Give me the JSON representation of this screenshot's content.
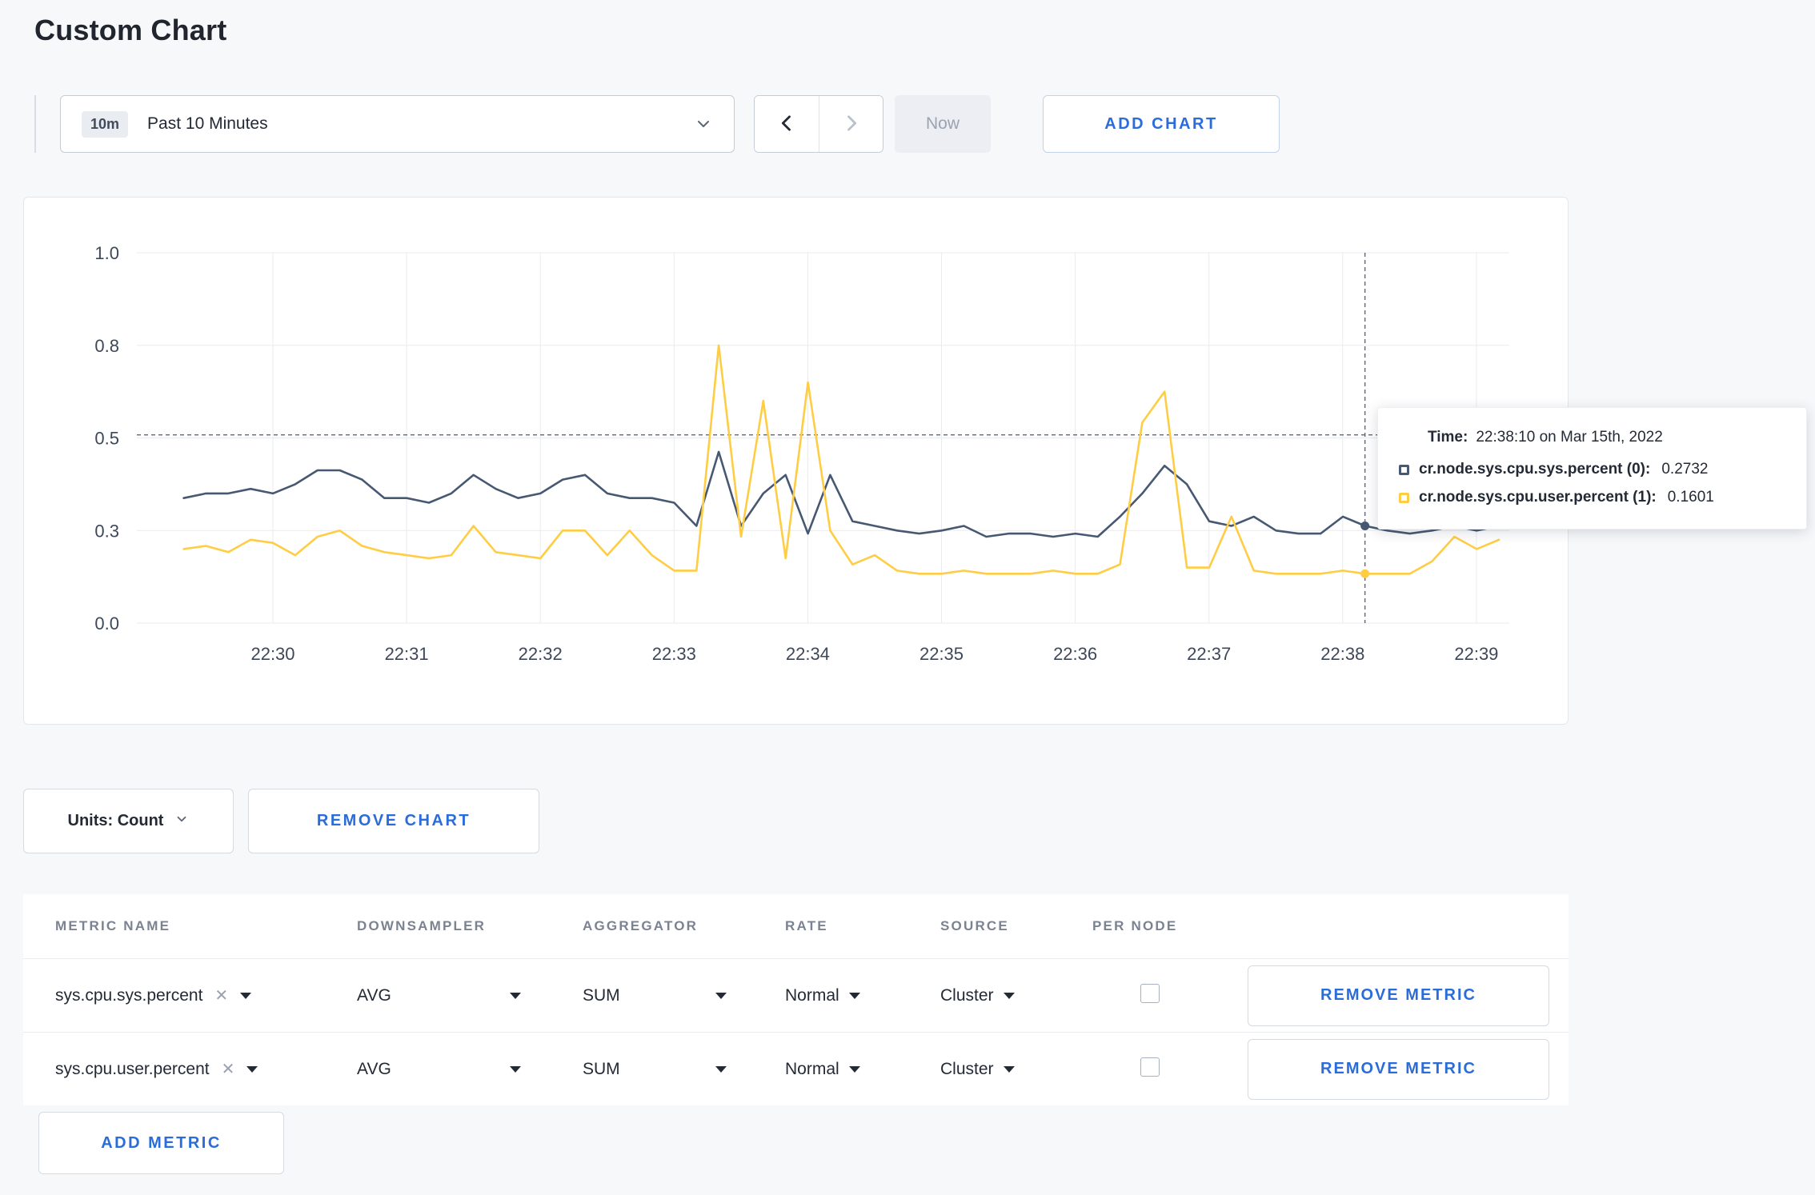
{
  "page": {
    "title": "Custom Chart"
  },
  "toolbar": {
    "time_range_badge": "10m",
    "time_range_label": "Past 10 Minutes",
    "now_label": "Now",
    "add_chart_label": "ADD CHART"
  },
  "controls": {
    "units_label": "Units: Count",
    "remove_chart_label": "REMOVE CHART",
    "add_metric_label": "ADD METRIC"
  },
  "icons": {
    "close": "✕"
  },
  "colors": {
    "accent_blue": "#2a6cd9"
  },
  "tooltip": {
    "time_label": "Time:",
    "time_value": "22:38:10 on Mar 15th, 2022",
    "series": [
      {
        "name": "cr.node.sys.cpu.sys.percent (0):",
        "value": "0.2732",
        "color": "#475872"
      },
      {
        "name": "cr.node.sys.cpu.user.percent (1):",
        "value": "0.1601",
        "color": "#ffcd44"
      }
    ]
  },
  "metrics_table": {
    "headers": [
      "METRIC NAME",
      "DOWNSAMPLER",
      "AGGREGATOR",
      "RATE",
      "SOURCE",
      "PER NODE"
    ],
    "rows": [
      {
        "metric": "sys.cpu.sys.percent",
        "downsampler": "AVG",
        "aggregator": "SUM",
        "rate": "Normal",
        "source": "Cluster",
        "per_node": false,
        "remove_label": "REMOVE METRIC"
      },
      {
        "metric": "sys.cpu.user.percent",
        "downsampler": "AVG",
        "aggregator": "SUM",
        "rate": "Normal",
        "source": "Cluster",
        "per_node": false,
        "remove_label": "REMOVE METRIC"
      }
    ]
  },
  "chart_data": {
    "type": "line",
    "title": "",
    "x_tick_labels": [
      "22:30",
      "22:31",
      "22:32",
      "22:33",
      "22:34",
      "22:35",
      "22:36",
      "22:37",
      "22:38",
      "22:39"
    ],
    "y_tick_labels": [
      "0.0",
      "0.3",
      "0.5",
      "0.8",
      "1.0"
    ],
    "y_tick_values": [
      0,
      0.3,
      0.5,
      0.8,
      1.0
    ],
    "x_start_min": -0.6667,
    "x_step_min": 0.1667,
    "axis_color": "#3e4859",
    "grid_color": "#e9ebef",
    "crosshair": {
      "time": "22:38:10",
      "x_min": 8.1667,
      "hline_value": 0.51,
      "color": "#5a6880"
    },
    "series": [
      {
        "name": "cr.node.sys.cpu.sys.percent",
        "color": "#475872",
        "values": [
          0.37,
          0.38,
          0.38,
          0.39,
          0.38,
          0.4,
          0.43,
          0.43,
          0.41,
          0.37,
          0.37,
          0.36,
          0.38,
          0.42,
          0.39,
          0.37,
          0.38,
          0.41,
          0.42,
          0.38,
          0.37,
          0.37,
          0.36,
          0.31,
          0.47,
          0.31,
          0.38,
          0.42,
          0.29,
          0.42,
          0.32,
          0.31,
          0.3,
          0.29,
          0.3,
          0.31,
          0.28,
          0.29,
          0.29,
          0.28,
          0.29,
          0.28,
          0.33,
          0.38,
          0.44,
          0.4,
          0.32,
          0.31,
          0.33,
          0.3,
          0.29,
          0.29,
          0.33,
          0.31,
          0.3,
          0.29,
          0.3,
          0.31,
          0.3,
          0.31
        ]
      },
      {
        "name": "cr.node.sys.cpu.user.percent",
        "color": "#ffcd44",
        "values": [
          0.24,
          0.25,
          0.23,
          0.27,
          0.26,
          0.22,
          0.28,
          0.3,
          0.25,
          0.23,
          0.22,
          0.21,
          0.22,
          0.31,
          0.23,
          0.22,
          0.21,
          0.3,
          0.3,
          0.22,
          0.3,
          0.22,
          0.17,
          0.17,
          0.8,
          0.28,
          0.62,
          0.21,
          0.68,
          0.3,
          0.19,
          0.22,
          0.17,
          0.16,
          0.16,
          0.17,
          0.16,
          0.16,
          0.16,
          0.17,
          0.16,
          0.16,
          0.19,
          0.55,
          0.65,
          0.18,
          0.18,
          0.33,
          0.17,
          0.16,
          0.16,
          0.16,
          0.17,
          0.16,
          0.16,
          0.16,
          0.2,
          0.28,
          0.24,
          0.27
        ]
      }
    ]
  }
}
